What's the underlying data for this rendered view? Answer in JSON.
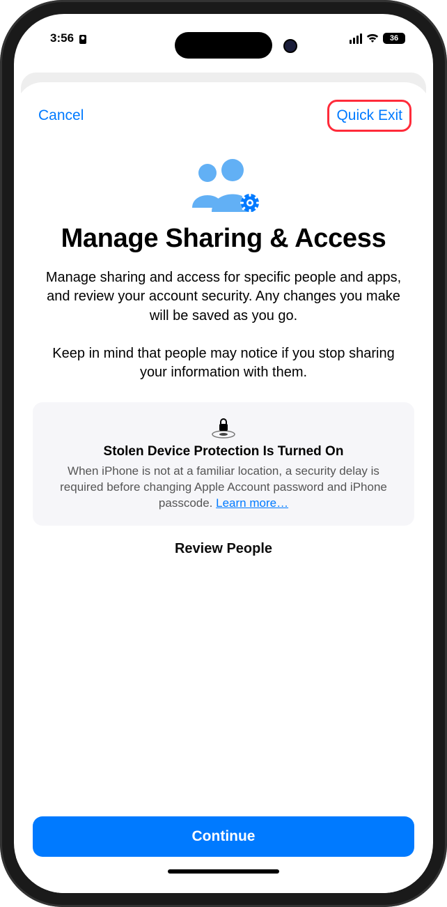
{
  "statusBar": {
    "time": "3:56",
    "battery": "36"
  },
  "nav": {
    "cancel": "Cancel",
    "quickExit": "Quick Exit"
  },
  "hero": {
    "title": "Manage Sharing & Access",
    "desc1": "Manage sharing and access for specific people and apps, and review your account security. Any changes you make will be saved as you go.",
    "desc2": "Keep in mind that people may notice if you stop sharing your information with them."
  },
  "card": {
    "title": "Stolen Device Protection Is Turned On",
    "desc": "When iPhone is not at a familiar location, a security delay is required before changing Apple Account password and iPhone passcode. ",
    "link": "Learn more…"
  },
  "peek": "Review People",
  "cta": "Continue"
}
